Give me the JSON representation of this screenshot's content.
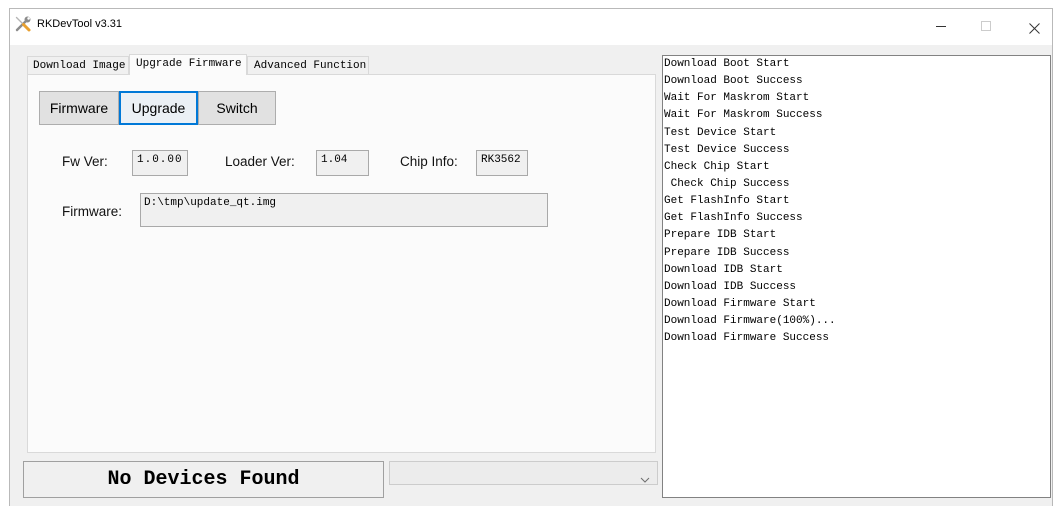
{
  "window": {
    "title": "RKDevTool v3.31",
    "maximize_enabled": false,
    "icons": {
      "app": "tools-icon",
      "minimize": "minimize-icon",
      "maximize": "maximize-icon",
      "close": "close-icon"
    }
  },
  "tabs": {
    "active_index": 1,
    "items": [
      {
        "label": "Download Image"
      },
      {
        "label": "Upgrade Firmware"
      },
      {
        "label": "Advanced Function"
      }
    ]
  },
  "upgrade_firmware": {
    "buttons": {
      "focused_index": 1,
      "items": [
        {
          "label": "Firmware"
        },
        {
          "label": "Upgrade"
        },
        {
          "label": "Switch"
        }
      ]
    },
    "fw_ver": {
      "label": "Fw Ver:",
      "value": "1.0.00"
    },
    "loader_ver": {
      "label": "Loader Ver:",
      "value": "1.04"
    },
    "chip_info": {
      "label": "Chip Info:",
      "value": "RK3562"
    },
    "firmware_path": {
      "label": "Firmware:",
      "value": "D:\\tmp\\update_qt.img"
    }
  },
  "status": {
    "text": "No Devices Found"
  },
  "device_select": {
    "icon": "chevron-down-icon"
  },
  "log": {
    "lines": [
      "Download Boot Start",
      "Download Boot Success",
      "Wait For Maskrom Start",
      "Wait For Maskrom Success",
      "Test Device Start",
      "Test Device Success",
      "Check Chip Start",
      " Check Chip Success",
      "Get FlashInfo Start",
      "Get FlashInfo Success",
      "Prepare IDB Start",
      "Prepare IDB Success",
      "Download IDB Start",
      "Download IDB Success",
      "Download Firmware Start",
      "Download Firmware(100%)...",
      "Download Firmware Success"
    ]
  },
  "colors": {
    "window_bg": "#f0f0f0",
    "tab_page_bg": "#fbfbfb",
    "focus_border": "#0078d7",
    "log_bg": "#ffffff",
    "text": "#000000"
  }
}
